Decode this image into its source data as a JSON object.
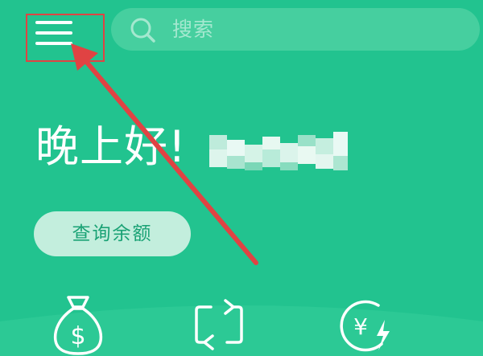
{
  "colors": {
    "background": "#22c38f",
    "search_bar": "#46cf9f",
    "button_bg": "#c3eedd",
    "button_text": "#1aa275",
    "annotation": "#e04343",
    "icon_stroke": "#ffffff"
  },
  "header": {
    "menu_icon": "hamburger-menu-icon",
    "search": {
      "icon": "search-icon",
      "placeholder": "搜索"
    }
  },
  "main": {
    "greeting": "晚上好!",
    "balance_button": "查询余额"
  },
  "shortcuts": [
    {
      "icon": "money-bag-dollar-icon"
    },
    {
      "icon": "transfer-arrows-icon"
    },
    {
      "icon": "yuan-lightning-icon"
    }
  ]
}
